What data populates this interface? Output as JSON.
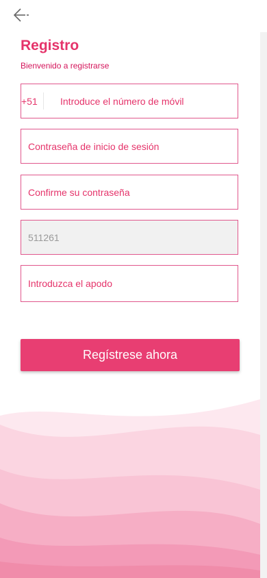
{
  "header": {
    "back_icon": "arrow-left-icon"
  },
  "title": "Registro",
  "subtitle": "Bienvenido a registrarse",
  "form": {
    "phone_prefix": "+51",
    "phone_placeholder": "Introduce el número de móvil",
    "password_placeholder": "Contraseña de inicio de sesión",
    "confirm_placeholder": "Confirme su contraseña",
    "invite_code_value": "511261",
    "nickname_placeholder": "Introduzca el apodo"
  },
  "submit_label": "Regístrese ahora",
  "colors": {
    "accent": "#e5336a",
    "button": "#e83e72",
    "border": "#e0568c"
  }
}
